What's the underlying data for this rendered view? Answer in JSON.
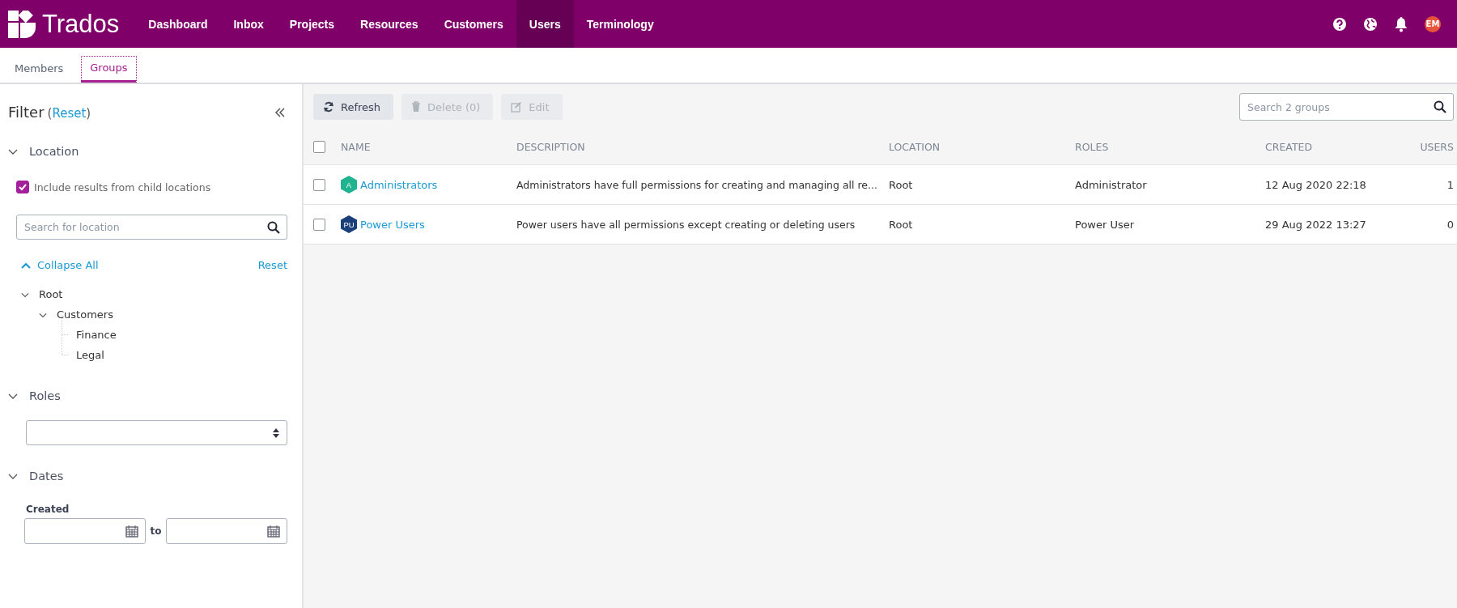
{
  "app": {
    "logo_text": "Trados"
  },
  "nav": [
    {
      "label": "Dashboard",
      "selected": false
    },
    {
      "label": "Inbox",
      "selected": false
    },
    {
      "label": "Projects",
      "selected": false
    },
    {
      "label": "Resources",
      "selected": false
    },
    {
      "label": "Customers",
      "selected": false
    },
    {
      "label": "Users",
      "selected": true
    },
    {
      "label": "Terminology",
      "selected": false
    }
  ],
  "user": {
    "initials": "EM"
  },
  "subtabs": [
    {
      "label": "Members",
      "selected": false
    },
    {
      "label": "Groups",
      "selected": true
    }
  ],
  "filter": {
    "title": "Filter",
    "paren_open": "(",
    "reset_link": "Reset",
    "paren_close": ")",
    "location": {
      "heading": "Location",
      "expanded": true,
      "include_children": {
        "label": "Include results from child locations",
        "checked": true
      },
      "search": {
        "placeholder": "Search for location"
      },
      "collapse_all": "Collapse All",
      "reset": "Reset",
      "tree": [
        {
          "label": "Root",
          "expanded": true,
          "children": [
            {
              "label": "Customers",
              "expanded": true,
              "children": [
                {
                  "label": "Finance"
                },
                {
                  "label": "Legal"
                }
              ]
            }
          ]
        }
      ]
    },
    "roles": {
      "heading": "Roles",
      "expanded": true
    },
    "dates": {
      "heading": "Dates",
      "expanded": true,
      "created_label": "Created",
      "to_label": "to"
    }
  },
  "toolbar": {
    "buttons": [
      {
        "label": "Refresh",
        "kind": "refresh",
        "disabled": false
      },
      {
        "label": "Delete (0)",
        "kind": "delete",
        "disabled": true
      },
      {
        "label": "Edit",
        "kind": "edit",
        "disabled": true
      }
    ],
    "search": {
      "placeholder": "Search 2 groups"
    }
  },
  "table": {
    "columns": [
      "NAME",
      "DESCRIPTION",
      "LOCATION",
      "ROLES",
      "CREATED",
      "USERS"
    ],
    "all_checked": false,
    "rows": [
      {
        "checked": false,
        "badge": "A",
        "color": "#1fb38f",
        "name": "Administrators",
        "description": "Administrators have full permissions for creating and managing all re...",
        "location": "Root",
        "roles": "Administrator",
        "created": "12 Aug 2020 22:18",
        "users": "1"
      },
      {
        "checked": false,
        "badge": "PU",
        "color": "#1a3f7a",
        "name": "Power Users",
        "description": "Power users have all permissions except creating or deleting users",
        "location": "Root",
        "roles": "Power User",
        "created": "29 Aug 2022 13:27",
        "users": "0"
      }
    ]
  }
}
